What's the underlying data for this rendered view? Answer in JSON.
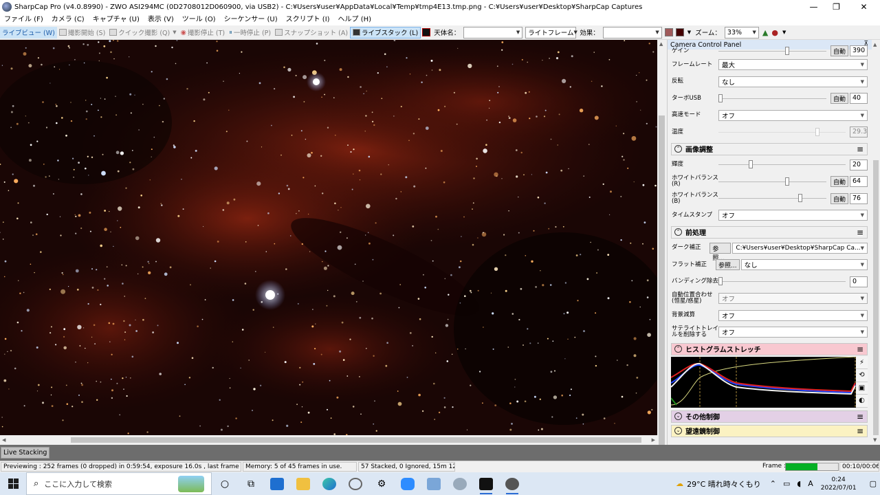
{
  "window": {
    "title": "SharpCap Pro (v4.0.8990) - ZWO ASI294MC (0D2708012D060900, via USB2) - C:¥Users¥user¥AppData¥Local¥Temp¥tmp4E13.tmp.png - C:¥Users¥user¥Desktop¥SharpCap Captures",
    "minimize": "—",
    "restore": "❐",
    "close": "✕"
  },
  "menu": [
    "ファイル (F)",
    "カメラ (C)",
    "キャプチャ (U)",
    "表示 (V)",
    "ツール (O)",
    "シーケンサー (U)",
    "スクリプト (I)",
    "ヘルプ (H)"
  ],
  "toolbar": {
    "live_view": "ライブビュー (W)",
    "start_capture": "撮影開始 (S)",
    "quick_capture": "クイック撮影 (Q)",
    "stop_capture": "撮影停止 (T)",
    "pause": "一時停止 (P)",
    "snapshot": "スナップショット (A)",
    "live_stack": "ライブスタック (L)",
    "object_label": "天体名：",
    "object_value": "",
    "frame_type": "ライトフレーム",
    "effect_label": "効果：",
    "effect_value": "",
    "zoom_label": "ズーム：",
    "zoom_value": "33%"
  },
  "panel": {
    "title": "Camera Control Panel",
    "auto": "自動",
    "camera_rows": {
      "gain": {
        "label": "ゲイン",
        "value": "390"
      },
      "frame_rate": {
        "label": "フレームレート",
        "value": "最大"
      },
      "flip": {
        "label": "反転",
        "value": "なし"
      },
      "turbo_usb": {
        "label": "ターボUSB",
        "value": "40"
      },
      "high_speed": {
        "label": "高速モード",
        "value": "オフ"
      },
      "temperature": {
        "label": "温度",
        "value": "29.3"
      }
    },
    "image_section": {
      "title": "画像調整",
      "brightness": {
        "label": "輝度",
        "value": "20"
      },
      "wb_r": {
        "label": "ホワイトバランス(R)",
        "value": "64"
      },
      "wb_b": {
        "label": "ホワイトバランス(B)",
        "value": "76"
      },
      "timestamp": {
        "label": "タイムスタンプ",
        "value": "オフ"
      }
    },
    "preprocess_section": {
      "title": "前処理",
      "dark": {
        "label": "ダーク補正",
        "browse": "参照...",
        "value": "C:¥Users¥user¥Desktop¥SharpCap Ca..."
      },
      "flat": {
        "label": "フラット補正",
        "browse": "参照...",
        "value": "なし"
      },
      "banding": {
        "label": "バンディング除去",
        "value": "0"
      },
      "auto_align": {
        "label": "自動位置合わせ(恒星/惑星)",
        "value": "オフ"
      },
      "background": {
        "label": "背景減算",
        "value": "オフ"
      },
      "satellite": {
        "label": "サテライトトレイルを削除する",
        "value": "オフ"
      }
    },
    "histogram_title": "ヒストグラムストレッチ",
    "other_title": "その他制御",
    "telescope_title": "望遠鏡制御"
  },
  "live_stacking_tab": "Live Stacking",
  "status": {
    "previewing": "Previewing : 252 frames (0 dropped) in 0:59:54, exposure 16.0s , last frame 17.6s",
    "memory": "Memory: 5 of 45 frames in use.",
    "stacked": "57 Stacked, 0 Ignored, 15m 12s",
    "frame_label": "Frame :",
    "frame_progress": 0.6,
    "time": "00:10/00:06"
  },
  "taskbar": {
    "search_placeholder": "ここに入力して検索",
    "weather": "29°C  晴れ時々くもり",
    "ime": "A",
    "time": "0:24",
    "date": "2022/07/01"
  },
  "colors": {
    "accent": "#2b6cd4",
    "histogram_header": "#f8c8d0",
    "other_header": "#e3d0e6",
    "telescope_header": "#fbf2c2",
    "progress": "#06b025"
  }
}
